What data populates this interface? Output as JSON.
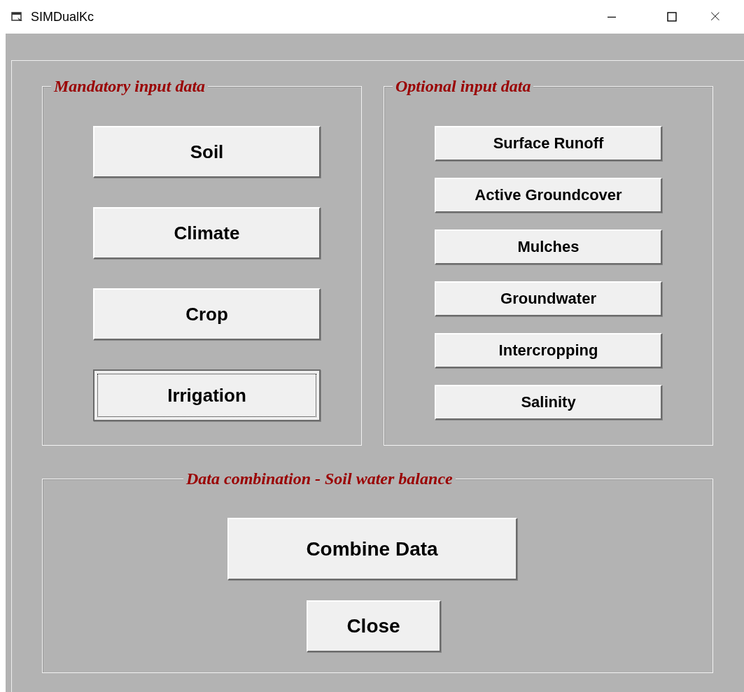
{
  "window": {
    "title": "SIMDualKc"
  },
  "groups": [
    {
      "title": "Mandatory input data",
      "kind": "large",
      "buttons": [
        {
          "label": "Soil",
          "focused": false
        },
        {
          "label": "Climate",
          "focused": false
        },
        {
          "label": "Crop",
          "focused": false
        },
        {
          "label": "Irrigation",
          "focused": true
        }
      ]
    },
    {
      "title": "Optional input data",
      "kind": "small",
      "buttons": [
        {
          "label": "Surface Runoff",
          "focused": false
        },
        {
          "label": "Active Groundcover",
          "focused": false
        },
        {
          "label": "Mulches",
          "focused": false
        },
        {
          "label": "Groundwater",
          "focused": false
        },
        {
          "label": "Intercropping",
          "focused": false
        },
        {
          "label": "Salinity",
          "focused": false
        }
      ]
    },
    {
      "title": "Data combination - Soil water balance",
      "kind": "center",
      "buttons": [
        {
          "label": "Combine Data",
          "focused": false
        },
        {
          "label": "Close",
          "focused": false
        }
      ]
    }
  ]
}
